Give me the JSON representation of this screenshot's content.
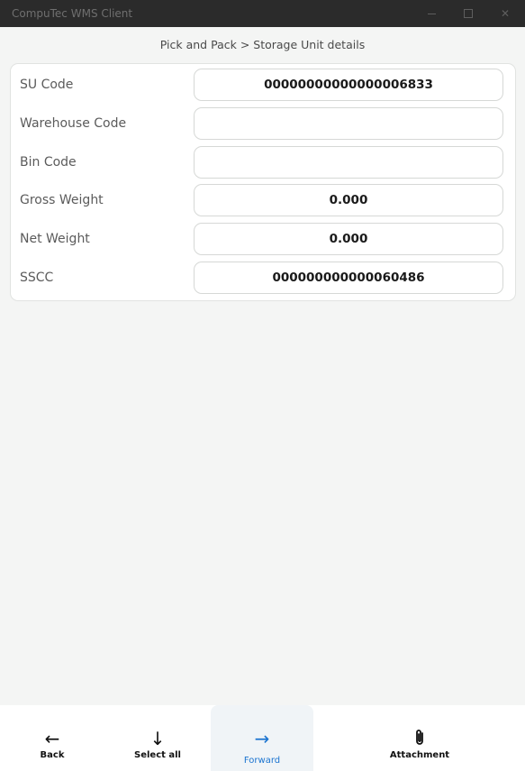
{
  "window": {
    "title": "CompuTec WMS Client",
    "controls": {
      "minimize": "",
      "maximize": "",
      "close": "✕"
    }
  },
  "breadcrumb": "Pick and Pack > Storage Unit details",
  "details": [
    {
      "label": "SU Code",
      "value": "00000000000000006833"
    },
    {
      "label": "Warehouse Code",
      "value": ""
    },
    {
      "label": "Bin Code",
      "value": ""
    },
    {
      "label": "Gross Weight",
      "value": "0.000"
    },
    {
      "label": "Net Weight",
      "value": "0.000"
    },
    {
      "label": "SSCC",
      "value": "000000000000060486"
    }
  ],
  "bottom_nav": {
    "back": {
      "label": "Back",
      "icon": "←"
    },
    "select_all": {
      "label": "Select all",
      "icon": "↓"
    },
    "forward": {
      "label": "Forward",
      "icon": "→"
    },
    "attachment": {
      "label": "Attachment",
      "icon": "paperclip-icon"
    }
  },
  "colors": {
    "titlebar": "#2b2b2b",
    "background": "#f4f5f4",
    "accent": "#1b74d0"
  }
}
